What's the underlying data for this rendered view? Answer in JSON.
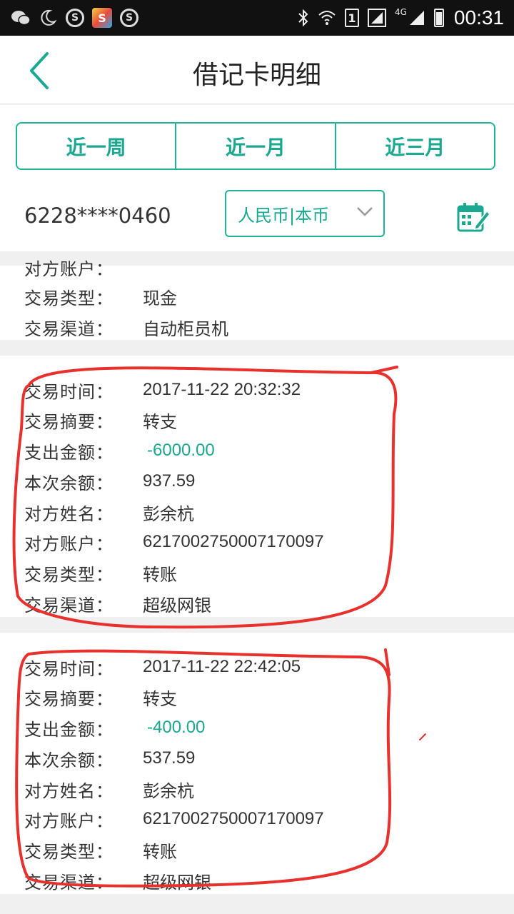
{
  "status_bar": {
    "time": "00:31",
    "sim_slot": "1",
    "network": "4G",
    "app_icon_letter": "S"
  },
  "header": {
    "title": "借记卡明细"
  },
  "period_tabs": [
    "近一周",
    "近一月",
    "近三月"
  ],
  "account": {
    "card_number": "6228****0460",
    "currency": "人民币|本币"
  },
  "transactions": [
    {
      "rows": [
        {
          "label": "对方账户：",
          "value": ""
        },
        {
          "label": "交易类型：",
          "value": "现金"
        },
        {
          "label": "交易渠道：",
          "value": "自动柜员机"
        }
      ]
    },
    {
      "rows": [
        {
          "label": "交易时间：",
          "value": "2017-11-22 20:32:32"
        },
        {
          "label": "交易摘要：",
          "value": "转支"
        },
        {
          "label": "支出金额：",
          "value": "-6000.00"
        },
        {
          "label": "本次余额：",
          "value": "937.59"
        },
        {
          "label": "对方姓名：",
          "value": "彭余杭"
        },
        {
          "label": "对方账户：",
          "value": "6217002750007170097"
        },
        {
          "label": "交易类型：",
          "value": "转账"
        },
        {
          "label": "交易渠道：",
          "value": "超级网银"
        }
      ]
    },
    {
      "rows": [
        {
          "label": "交易时间：",
          "value": "2017-11-22 22:42:05"
        },
        {
          "label": "交易摘要：",
          "value": "转支"
        },
        {
          "label": "支出金额：",
          "value": "-400.00"
        },
        {
          "label": "本次余额：",
          "value": "537.59"
        },
        {
          "label": "对方姓名：",
          "value": "彭余杭"
        },
        {
          "label": "对方账户：",
          "value": "6217002750007170097"
        },
        {
          "label": "交易类型：",
          "value": "转账"
        },
        {
          "label": "交易渠道：",
          "value": "超级网银"
        }
      ]
    }
  ],
  "colors": {
    "accent": "#1aa890",
    "marker": "#e8302c"
  }
}
